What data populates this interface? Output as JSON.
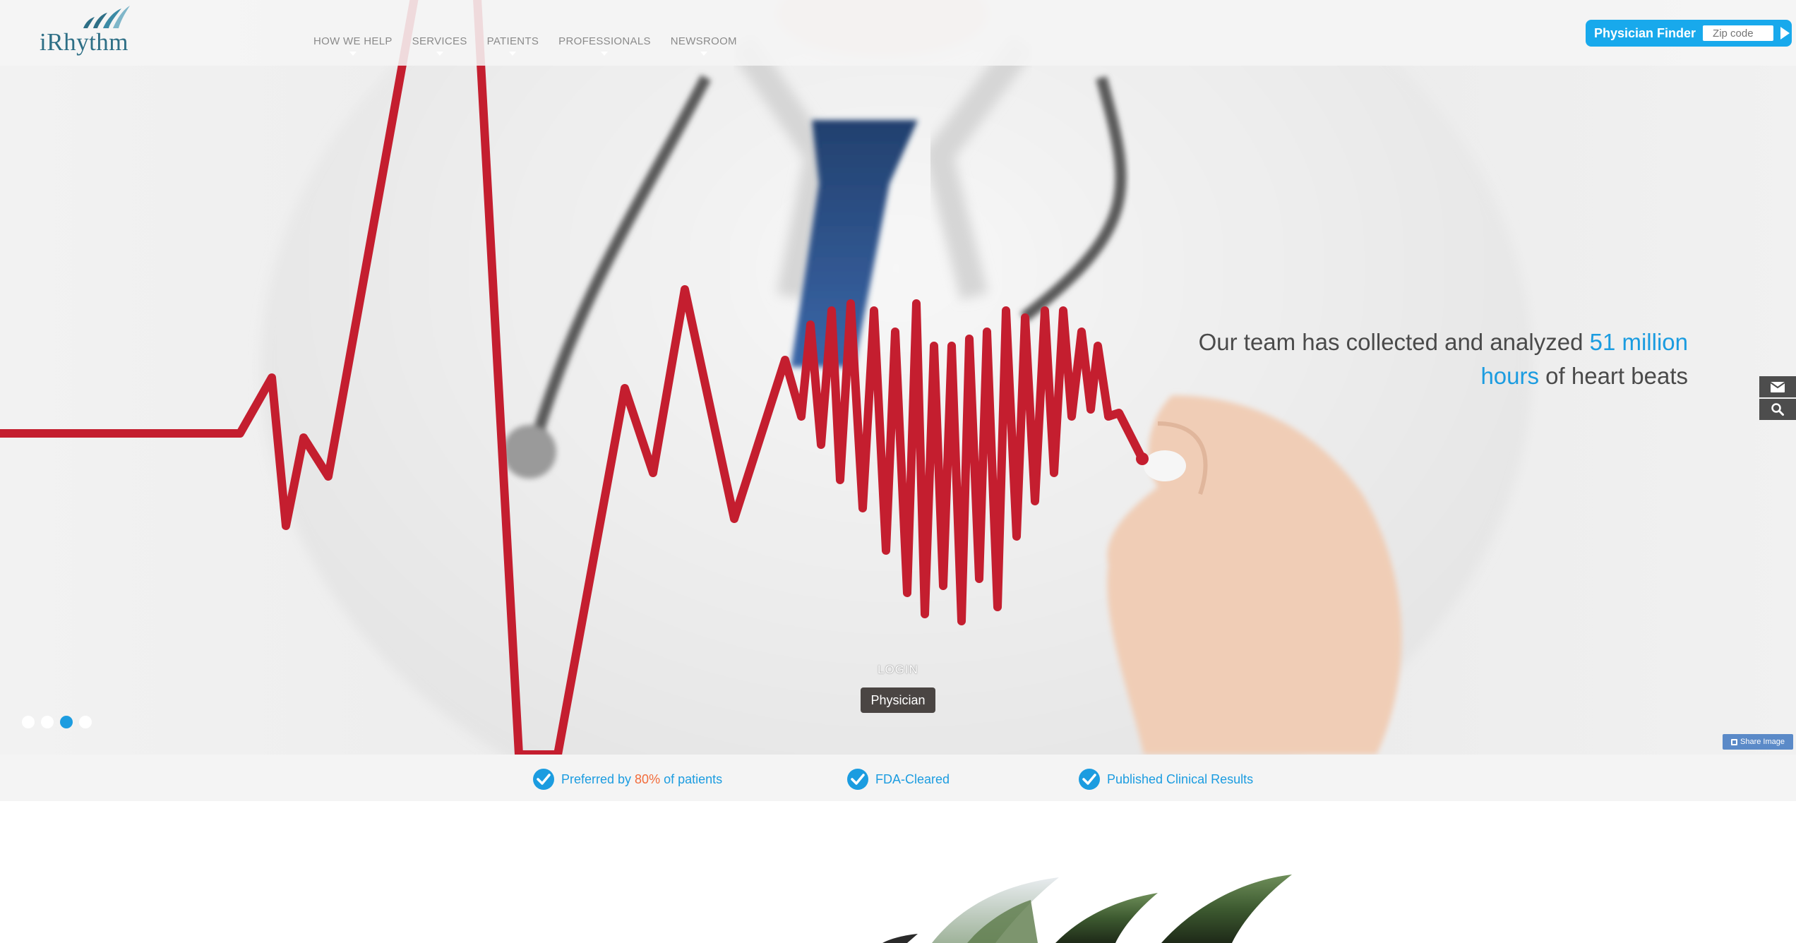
{
  "brand": {
    "logo_text": "iRhythm"
  },
  "nav": {
    "items": [
      {
        "label": "HOW WE HELP"
      },
      {
        "label": "SERVICES"
      },
      {
        "label": "PATIENTS"
      },
      {
        "label": "PROFESSIONALS"
      },
      {
        "label": "NEWSROOM"
      }
    ]
  },
  "physician_finder": {
    "label": "Physician Finder",
    "placeholder": "Zip code"
  },
  "hero": {
    "headline_part1": "Our team has collected and analyzed ",
    "headline_highlight1": "51 million",
    "headline_highlight2": "hours",
    "headline_part2": " of heart beats",
    "login_label": "LOGIN",
    "login_button": "Physician",
    "slides": {
      "count": 4,
      "active_index": 2
    },
    "share_label": "Share Image"
  },
  "side_tools": {
    "icons": [
      "mail-icon",
      "search-icon"
    ]
  },
  "features": {
    "items": [
      {
        "prefix": "Preferred by ",
        "highlight": "80%",
        "suffix": " of patients"
      },
      {
        "prefix": "FDA-Cleared"
      },
      {
        "prefix": "Published Clinical Results"
      }
    ]
  },
  "colors": {
    "accent": "#1b9ce0",
    "orange": "#f26b3a",
    "ecg_red": "#c41e2f",
    "finder_blue": "#18a9ec"
  }
}
